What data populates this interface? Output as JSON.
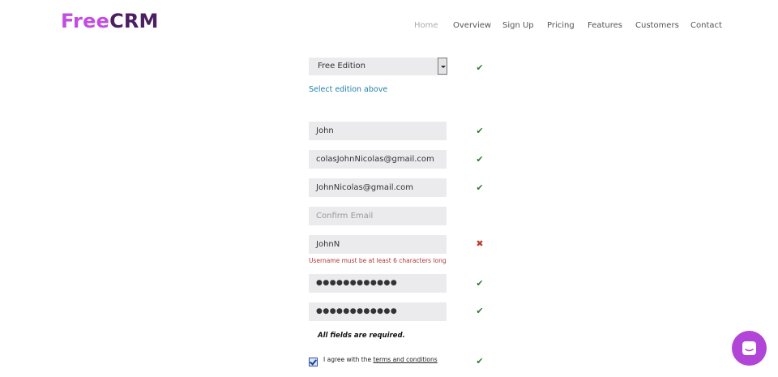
{
  "logo": {
    "part1": "Free",
    "part2": "CRM"
  },
  "nav": [
    {
      "label": "Home",
      "active": true
    },
    {
      "label": "Overview"
    },
    {
      "label": "Sign Up"
    },
    {
      "label": "Pricing"
    },
    {
      "label": "Features"
    },
    {
      "label": "Customers"
    },
    {
      "label": "Contact"
    }
  ],
  "form": {
    "edition": {
      "value": "Free Edition",
      "hint": "Select edition above"
    },
    "first_name": {
      "value": "John"
    },
    "last_name": {
      "value": "colasJohnNicolas@gmail.com"
    },
    "email": {
      "value": "JohnNicolas@gmail.com"
    },
    "confirm_email": {
      "placeholder": "Confirm Email"
    },
    "username": {
      "value": "JohnN",
      "error": "Username must be at least 6 characters long"
    },
    "password": {
      "value": "●●●●●●●●●●●●"
    },
    "confirm_password": {
      "value": "●●●●●●●●●●●●"
    },
    "required_note": "All fields are required.",
    "agree": {
      "prefix": "I agree with the ",
      "link": "terms and conditions",
      "checked": true
    }
  },
  "status_icons": {
    "valid": "✔",
    "invalid": "✖"
  },
  "colors": {
    "brand_light": "#c14ee0",
    "brand_dark": "#4c1f61",
    "valid": "#2e7d32",
    "invalid": "#c0392b",
    "link": "#1f7fa8",
    "chat": "#b145d7"
  },
  "icons": {
    "chat_launcher": "chat-bubble-icon"
  }
}
